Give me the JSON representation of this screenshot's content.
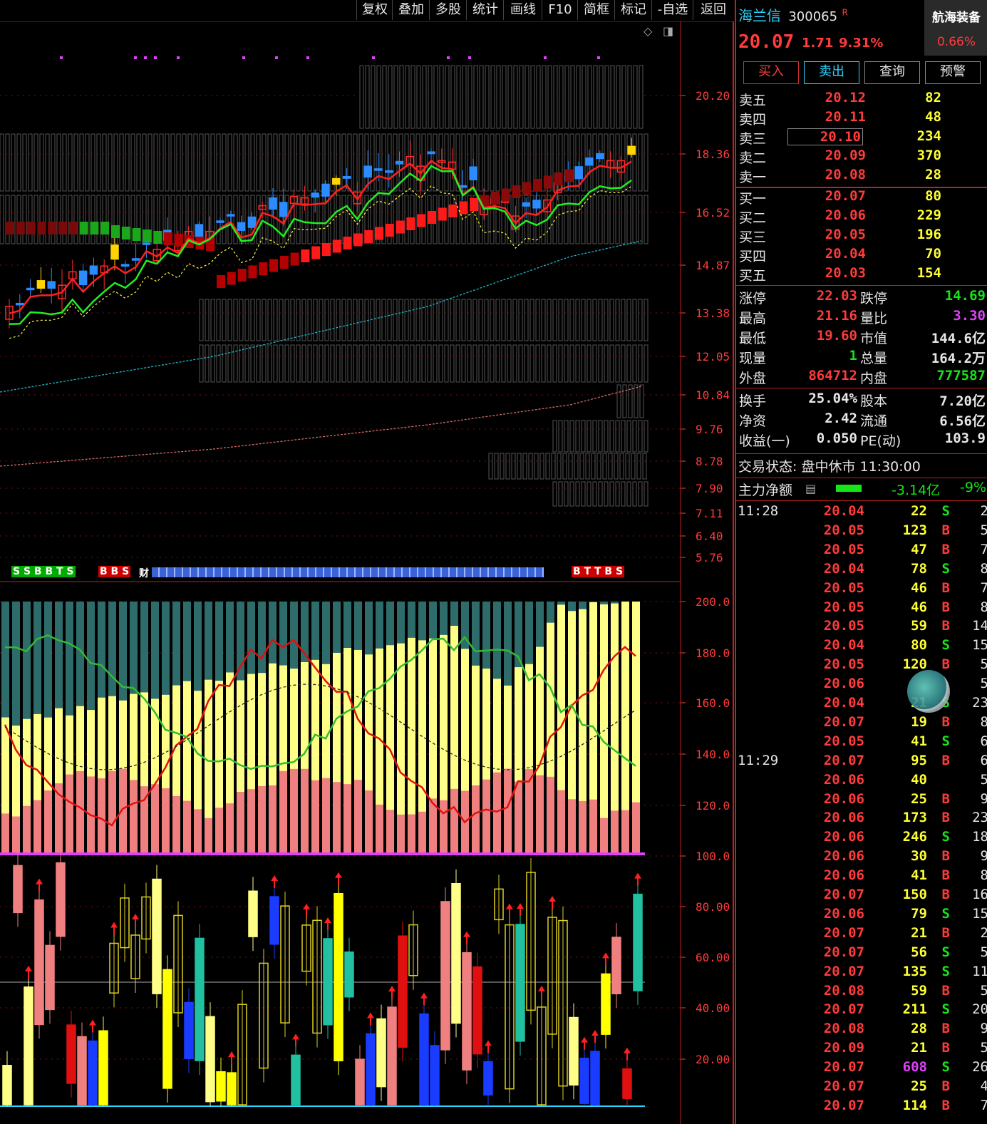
{
  "toolbar": {
    "items": [
      "复权",
      "叠加",
      "多股",
      "统计",
      "画线",
      "F10",
      "简框",
      "标记",
      "-自选",
      "返回"
    ]
  },
  "axes": {
    "main": [
      "20.20",
      "18.36",
      "16.52",
      "14.87",
      "13.38",
      "12.05",
      "10.84",
      "9.76",
      "8.78",
      "7.90",
      "7.11",
      "6.40",
      "5.76"
    ],
    "sub": [
      "200.0",
      "180.0",
      "160.0",
      "140.0",
      "120.0",
      "100.0",
      "80.00",
      "60.00",
      "40.00",
      "20.00"
    ]
  },
  "signal_strip": {
    "left": "S S B B T S",
    "mid": "B B S",
    "cai": "财",
    "right": "B T T B S"
  },
  "stock": {
    "name": "海兰信",
    "code": "300065",
    "suffix": "R",
    "sector": "航海装备",
    "price": "20.07",
    "change": "1.71",
    "pct": "9.31%",
    "sector_pct": "0.66%"
  },
  "buttons": [
    "买入",
    "卖出",
    "查询",
    "预警"
  ],
  "order_book": {
    "asks": [
      {
        "label": "卖五",
        "price": "20.12",
        "vol": "82"
      },
      {
        "label": "卖四",
        "price": "20.11",
        "vol": "48"
      },
      {
        "label": "卖三",
        "price": "20.10",
        "vol": "234"
      },
      {
        "label": "卖二",
        "price": "20.09",
        "vol": "370"
      },
      {
        "label": "卖一",
        "price": "20.08",
        "vol": "28"
      }
    ],
    "bids": [
      {
        "label": "买一",
        "price": "20.07",
        "vol": "80"
      },
      {
        "label": "买二",
        "price": "20.06",
        "vol": "229"
      },
      {
        "label": "买三",
        "price": "20.05",
        "vol": "196"
      },
      {
        "label": "买四",
        "price": "20.04",
        "vol": "70"
      },
      {
        "label": "买五",
        "price": "20.03",
        "vol": "154"
      }
    ]
  },
  "stats": [
    {
      "l1": "涨停",
      "v1": "22.03",
      "l2": "跌停",
      "v2": "14.69",
      "c1": "red",
      "c2": "green"
    },
    {
      "l1": "最高",
      "v1": "21.16",
      "l2": "量比",
      "v2": "3.30",
      "c1": "red",
      "c2": "magenta"
    },
    {
      "l1": "最低",
      "v1": "19.60",
      "l2": "市值",
      "v2": "144.6亿",
      "c1": "red",
      "c2": "white"
    },
    {
      "l1": "现量",
      "v1": "1",
      "l2": "总量",
      "v2": "164.2万",
      "c1": "green",
      "c2": "white"
    },
    {
      "l1": "外盘",
      "v1": "864712",
      "l2": "内盘",
      "v2": "777587",
      "c1": "red",
      "c2": "green"
    }
  ],
  "stats2": [
    {
      "l1": "换手",
      "v1": "25.04%",
      "l2": "股本",
      "v2": "7.20亿"
    },
    {
      "l1": "净资",
      "v1": "2.42",
      "l2": "流通",
      "v2": "6.56亿"
    },
    {
      "l1": "收益(一)",
      "v1": "0.050",
      "l2": "PE(动)",
      "v2": "103.9"
    }
  ],
  "status": {
    "label": "交易状态:",
    "value": "盘中休市 11:30:00"
  },
  "main_flow": {
    "label": "主力净额",
    "value": "-3.14亿",
    "pct": "-9%"
  },
  "ticks": [
    {
      "time": "11:28",
      "price": "20.04",
      "vol": "22",
      "bs": "S",
      "n": "2"
    },
    {
      "time": "",
      "price": "20.05",
      "vol": "123",
      "bs": "B",
      "n": "5"
    },
    {
      "time": "",
      "price": "20.05",
      "vol": "47",
      "bs": "B",
      "n": "7"
    },
    {
      "time": "",
      "price": "20.04",
      "vol": "78",
      "bs": "S",
      "n": "8"
    },
    {
      "time": "",
      "price": "20.05",
      "vol": "46",
      "bs": "B",
      "n": "7"
    },
    {
      "time": "",
      "price": "20.05",
      "vol": "46",
      "bs": "B",
      "n": "8"
    },
    {
      "time": "",
      "price": "20.05",
      "vol": "59",
      "bs": "B",
      "n": "14"
    },
    {
      "time": "",
      "price": "20.04",
      "vol": "80",
      "bs": "S",
      "n": "15"
    },
    {
      "time": "",
      "price": "20.05",
      "vol": "120",
      "bs": "B",
      "n": "5"
    },
    {
      "time": "",
      "price": "20.06",
      "vol": "",
      "bs": "",
      "n": "5"
    },
    {
      "time": "",
      "price": "20.04",
      "vol": "21",
      "bs": "S",
      "n": "23"
    },
    {
      "time": "",
      "price": "20.07",
      "vol": "19",
      "bs": "B",
      "n": "8"
    },
    {
      "time": "",
      "price": "20.05",
      "vol": "41",
      "bs": "S",
      "n": "6"
    },
    {
      "time": "11:29",
      "price": "20.07",
      "vol": "95",
      "bs": "B",
      "n": "6"
    },
    {
      "time": "",
      "price": "20.06",
      "vol": "40",
      "bs": "",
      "n": "5"
    },
    {
      "time": "",
      "price": "20.06",
      "vol": "25",
      "bs": "B",
      "n": "9"
    },
    {
      "time": "",
      "price": "20.06",
      "vol": "173",
      "bs": "B",
      "n": "23"
    },
    {
      "time": "",
      "price": "20.06",
      "vol": "246",
      "bs": "S",
      "n": "18"
    },
    {
      "time": "",
      "price": "20.06",
      "vol": "30",
      "bs": "B",
      "n": "9"
    },
    {
      "time": "",
      "price": "20.06",
      "vol": "41",
      "bs": "B",
      "n": "8"
    },
    {
      "time": "",
      "price": "20.07",
      "vol": "150",
      "bs": "B",
      "n": "16"
    },
    {
      "time": "",
      "price": "20.06",
      "vol": "79",
      "bs": "S",
      "n": "15"
    },
    {
      "time": "",
      "price": "20.07",
      "vol": "21",
      "bs": "B",
      "n": "2"
    },
    {
      "time": "",
      "price": "20.07",
      "vol": "56",
      "bs": "S",
      "n": "5"
    },
    {
      "time": "",
      "price": "20.07",
      "vol": "135",
      "bs": "S",
      "n": "11"
    },
    {
      "time": "",
      "price": "20.08",
      "vol": "59",
      "bs": "B",
      "n": "5"
    },
    {
      "time": "",
      "price": "20.07",
      "vol": "211",
      "bs": "S",
      "n": "20"
    },
    {
      "time": "",
      "price": "20.08",
      "vol": "28",
      "bs": "B",
      "n": "9"
    },
    {
      "time": "",
      "price": "20.09",
      "vol": "21",
      "bs": "B",
      "n": "5"
    },
    {
      "time": "",
      "price": "20.07",
      "vol": "608",
      "bs": "S",
      "n": "26"
    },
    {
      "time": "",
      "price": "20.07",
      "vol": "25",
      "bs": "B",
      "n": "4"
    },
    {
      "time": "",
      "price": "20.07",
      "vol": "114",
      "bs": "B",
      "n": "7"
    }
  ],
  "colors": {
    "up": "#ff2a2a",
    "down": "#16e516",
    "axis": "#ff3b3b",
    "cyan": "#2ad4ff"
  }
}
